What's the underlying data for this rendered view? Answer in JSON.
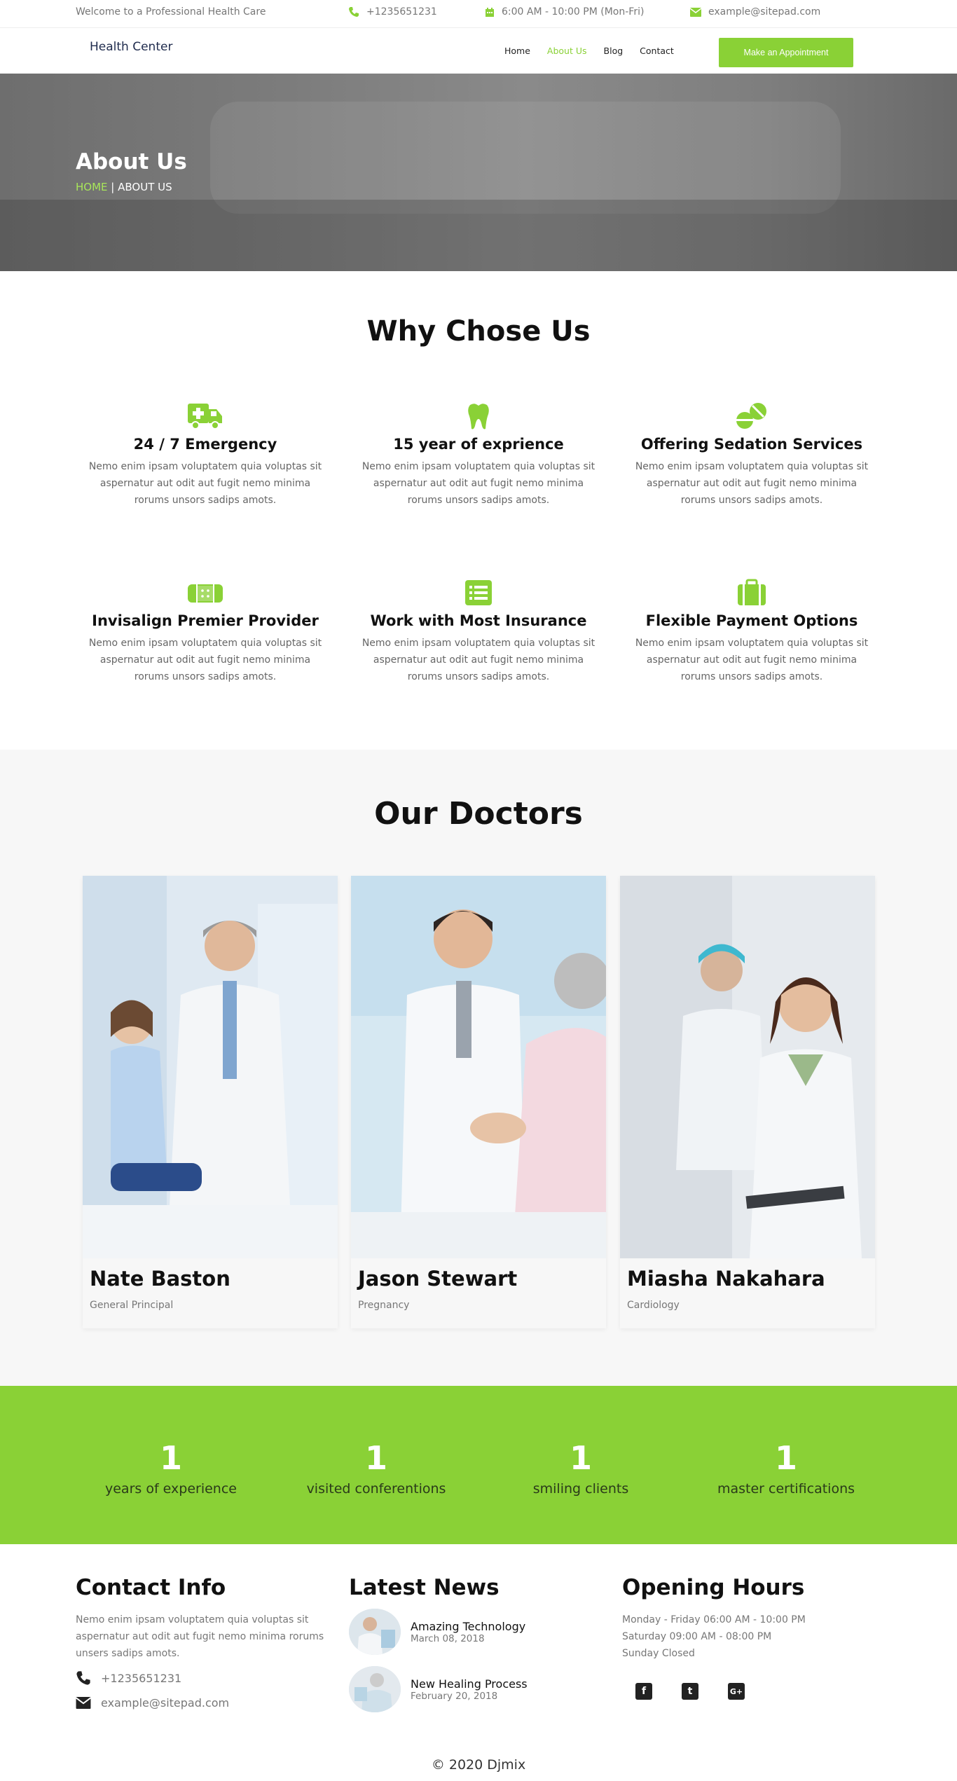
{
  "topbar": {
    "welcome": "Welcome to a Professional Health Care",
    "phone": "+1235651231",
    "hours": "6:00 AM - 10:00 PM (Mon-Fri)",
    "email": "example@sitepad.com",
    "phone_icon": "phone-icon",
    "calendar_icon": "calendar-icon",
    "email_icon": "envelope-icon"
  },
  "nav": {
    "brand": "Health Center",
    "items": [
      "Home",
      "About Us",
      "Blog",
      "Contact"
    ],
    "active": "About Us",
    "cta": "Make an Appointment"
  },
  "hero": {
    "title": "About Us",
    "crumb_home": "HOME",
    "crumb_sep": "|",
    "crumb_current": "ABOUT US"
  },
  "why": {
    "title": "Why Chose Us",
    "features": [
      {
        "icon": "ambulance-icon",
        "title": "24 / 7 Emergency",
        "text": "Nemo enim ipsam voluptatem quia voluptas sit aspernatur aut odit aut fugit nemo minima rorums unsors sadips amots."
      },
      {
        "icon": "tooth-icon",
        "title": "15 year of exprience",
        "text": "Nemo enim ipsam voluptatem quia voluptas sit aspernatur aut odit aut fugit nemo minima rorums unsors sadips amots."
      },
      {
        "icon": "pills-icon",
        "title": "Offering Sedation Services",
        "text": "Nemo enim ipsam voluptatem quia voluptas sit aspernatur aut odit aut fugit nemo minima rorums unsors sadips amots."
      },
      {
        "icon": "band-aid-icon",
        "title": "Invisalign Premier Provider",
        "text": "Nemo enim ipsam voluptatem quia voluptas sit aspernatur aut odit aut fugit nemo minima rorums unsors sadips amots."
      },
      {
        "icon": "list-icon",
        "title": "Work with Most Insurance",
        "text": "Nemo enim ipsam voluptatem quia voluptas sit aspernatur aut odit aut fugit nemo minima rorums unsors sadips amots."
      },
      {
        "icon": "suitcase-icon",
        "title": "Flexible Payment Options",
        "text": "Nemo enim ipsam voluptatem quia voluptas sit aspernatur aut odit aut fugit nemo minima rorums unsors sadips amots."
      }
    ]
  },
  "doctors": {
    "title": "Our Doctors",
    "list": [
      {
        "name": "Nate Baston",
        "role": "General Principal"
      },
      {
        "name": "Jason Stewart",
        "role": "Pregnancy"
      },
      {
        "name": "Miasha Nakahara",
        "role": "Cardiology"
      }
    ]
  },
  "stats": [
    {
      "value": "1",
      "label": "years of experience"
    },
    {
      "value": "1",
      "label": "visited conferentions"
    },
    {
      "value": "1",
      "label": "smiling clients"
    },
    {
      "value": "1",
      "label": "master certifications"
    }
  ],
  "footer": {
    "contact": {
      "title": "Contact Info",
      "text": " Nemo enim ipsam voluptatem quia voluptas sit aspernatur aut odit aut fugit nemo minima rorums unsers sadips amots.",
      "phone": "+1235651231",
      "email": "example@sitepad.com"
    },
    "news": {
      "title": "Latest News",
      "items": [
        {
          "title": "Amazing Technology",
          "date": "March 08, 2018"
        },
        {
          "title": "New Healing Process",
          "date": "February 20, 2018"
        }
      ]
    },
    "hours": {
      "title": "Opening Hours",
      "lines": [
        "Monday - Friday 06:00 AM - 10:00 PM",
        "Saturday 09:00 AM - 08:00 PM",
        "Sunday Closed"
      ]
    },
    "social": [
      {
        "icon": "facebook-icon",
        "glyph": "f"
      },
      {
        "icon": "twitter-icon",
        "glyph": "t"
      },
      {
        "icon": "google-plus-icon",
        "glyph": "G+"
      }
    ],
    "copyright": "© 2020 Djmix"
  },
  "colors": {
    "accent": "#8ad136",
    "dark": "#111111",
    "muted": "#777777"
  }
}
